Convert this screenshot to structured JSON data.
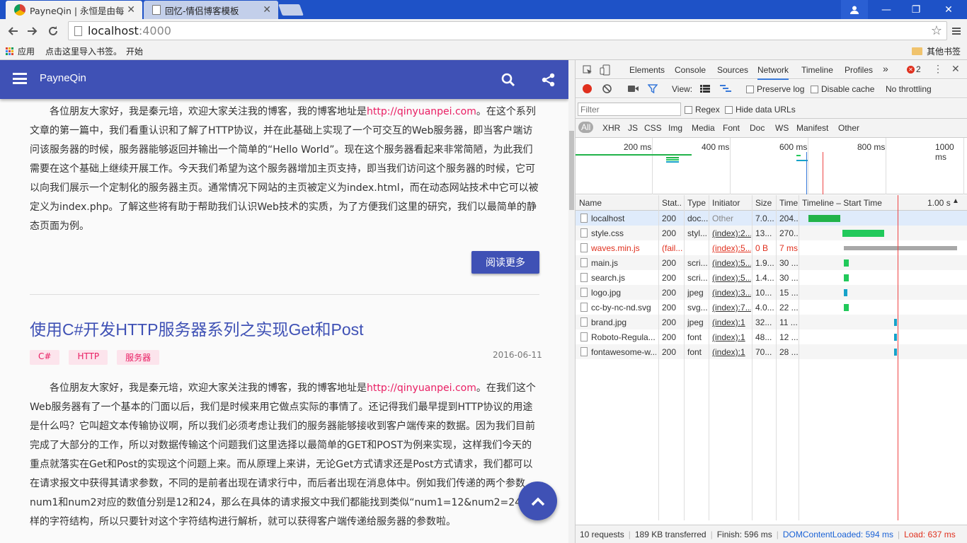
{
  "tabs": [
    {
      "title": "PayneQin | 永恒是由每一",
      "active": true
    },
    {
      "title": "回忆-情侣博客模板",
      "active": false
    }
  ],
  "address": {
    "host": "localhost",
    "port": ":4000"
  },
  "bookmarks": {
    "apps": "应用",
    "import": "点击这里导入书签。",
    "start": "开始",
    "other": "其他书签"
  },
  "blog": {
    "brand": "PayneQin",
    "para1_before": "各位朋友大家好，我是秦元培，欢迎大家关注我的博客，我的博客地址是",
    "link": "http://qinyuanpei.com",
    "para1_after": "。在这个系列文章的第一篇中，我们看重认识和了解了HTTP协议，并在此基础上实现了一个可交互的Web服务器，即当客户端访问该服务器的时候，服务器能够返回并输出一个简单的“Hello World”。现在这个服务器看起来非常简陋，为此我们需要在这个基础上继续开展工作。今天我们希望为这个服务器增加主页支持，即当我们访问这个服务器的时候，它可以向我们展示一个定制化的服务器主页。通常情况下网站的主页被定义为index.html，而在动态网站技术中它可以被定义为index.php。了解这些将有助于帮助我们认识Web技术的实质，为了方便我们这里的研究，我们以最简单的静态页面为例。",
    "read_more": "阅读更多",
    "post_title": "使用C#开发HTTP服务器系列之实现Get和Post",
    "tags": [
      "C#",
      "HTTP",
      "服务器"
    ],
    "date": "2016-06-11",
    "para2_before": "各位朋友大家好，我是秦元培，欢迎大家关注我的博客，我的博客地址是",
    "para2_after": "。在我们这个Web服务器有了一个基本的门面以后，我们是时候来用它做点实际的事情了。还记得我们最早提到HTTP协议的用途是什么吗？它叫超文本传输协议啊，所以我们必须考虑让我们的服务器能够接收到客户端传来的数据。因为我们目前完成了大部分的工作，所以对数据传输这个问题我们这里选择以最简单的GET和POST为例来实现，这样我们今天的重点就落实在Get和Post的实现这个问题上来。而从原理上来讲，无论Get方式请求还是Post方式请求，我们都可以在请求报文中获得其请求参数，不同的是前者出现在请求行中，而后者出现在消息体中。例如我们传递的两个参数num1和num2对应的数值分别是12和24，那么在具体的请求报文中我们都能找到类似“num1=12&num2=24”这样的字符结构，所以只要针对这个字符结构进行解析，就可以获得客户端传递给服务器的参数啦。"
  },
  "devtools": {
    "panels": [
      "Elements",
      "Console",
      "Sources",
      "Network",
      "Timeline",
      "Profiles"
    ],
    "more": "»",
    "errors": "2",
    "view_label": "View:",
    "preserve_log": "Preserve log",
    "disable_cache": "Disable cache",
    "throttling": "No throttling",
    "filter_placeholder": "Filter",
    "regex": "Regex",
    "hide_data_urls": "Hide data URLs",
    "types": [
      "All",
      "XHR",
      "JS",
      "CSS",
      "Img",
      "Media",
      "Font",
      "Doc",
      "WS",
      "Manifest",
      "Other"
    ],
    "overview_ticks": [
      "200 ms",
      "400 ms",
      "600 ms",
      "800 ms",
      "1000 ms"
    ],
    "columns": [
      "Name",
      "Stat..",
      "Type",
      "Initiator",
      "Size",
      "Time",
      "Timeline – Start Time"
    ],
    "timeline_end": "1.00 s",
    "rows": [
      {
        "name": "localhost",
        "status": "200",
        "type": "doc...",
        "initiator": "Other",
        "size": "7.0...",
        "time": "204...",
        "bar_start": 0.05,
        "bar_end": 0.25,
        "color": "#21b34a",
        "selected": true,
        "error": false
      },
      {
        "name": "style.css",
        "status": "200",
        "type": "styl...",
        "initiator": "(index):2...",
        "size": "13...",
        "time": "270...",
        "bar_start": 0.26,
        "bar_end": 0.52,
        "color": "#21c95a",
        "error": false
      },
      {
        "name": "waves.min.js",
        "status": "(fail...",
        "type": "",
        "initiator": "(index):5...",
        "size": "0 B",
        "time": "7 ms",
        "bar_start": 0.27,
        "bar_end": 0.98,
        "color": "#a8a8a8",
        "error": true
      },
      {
        "name": "main.js",
        "status": "200",
        "type": "scri...",
        "initiator": "(index):5...",
        "size": "1.9...",
        "time": "30 ...",
        "bar_start": 0.27,
        "bar_end": 0.3,
        "color": "#21c95a",
        "error": false
      },
      {
        "name": "search.js",
        "status": "200",
        "type": "scri...",
        "initiator": "(index):5...",
        "size": "1.4...",
        "time": "30 ...",
        "bar_start": 0.27,
        "bar_end": 0.3,
        "color": "#21c95a",
        "error": false
      },
      {
        "name": "logo.jpg",
        "status": "200",
        "type": "jpeg",
        "initiator": "(index):3...",
        "size": "10...",
        "time": "15 ...",
        "bar_start": 0.27,
        "bar_end": 0.29,
        "color": "#17a2c9",
        "error": false
      },
      {
        "name": "cc-by-nc-nd.svg",
        "status": "200",
        "type": "svg...",
        "initiator": "(index):7...",
        "size": "4.0...",
        "time": "22 ...",
        "bar_start": 0.27,
        "bar_end": 0.3,
        "color": "#21c95a",
        "error": false
      },
      {
        "name": "brand.jpg",
        "status": "200",
        "type": "jpeg",
        "initiator": "(index):1",
        "size": "32...",
        "time": "11 ...",
        "bar_start": 0.585,
        "bar_end": 0.6,
        "color": "#17a2c9",
        "error": false
      },
      {
        "name": "Roboto-Regula...",
        "status": "200",
        "type": "font",
        "initiator": "(index):1",
        "size": "48...",
        "time": "12 ...",
        "bar_start": 0.585,
        "bar_end": 0.6,
        "color": "#17a2c9",
        "error": false
      },
      {
        "name": "fontawesome-w...",
        "status": "200",
        "type": "font",
        "initiator": "(index):1",
        "size": "70...",
        "time": "28 ...",
        "bar_start": 0.585,
        "bar_end": 0.6,
        "color": "#17a2c9",
        "error": false
      }
    ],
    "status_bar": {
      "requests": "10 requests",
      "transferred": "189 KB transferred",
      "finish": "Finish: 596 ms",
      "dom": "DOMContentLoaded: 594 ms",
      "load": "Load: 637 ms"
    }
  }
}
